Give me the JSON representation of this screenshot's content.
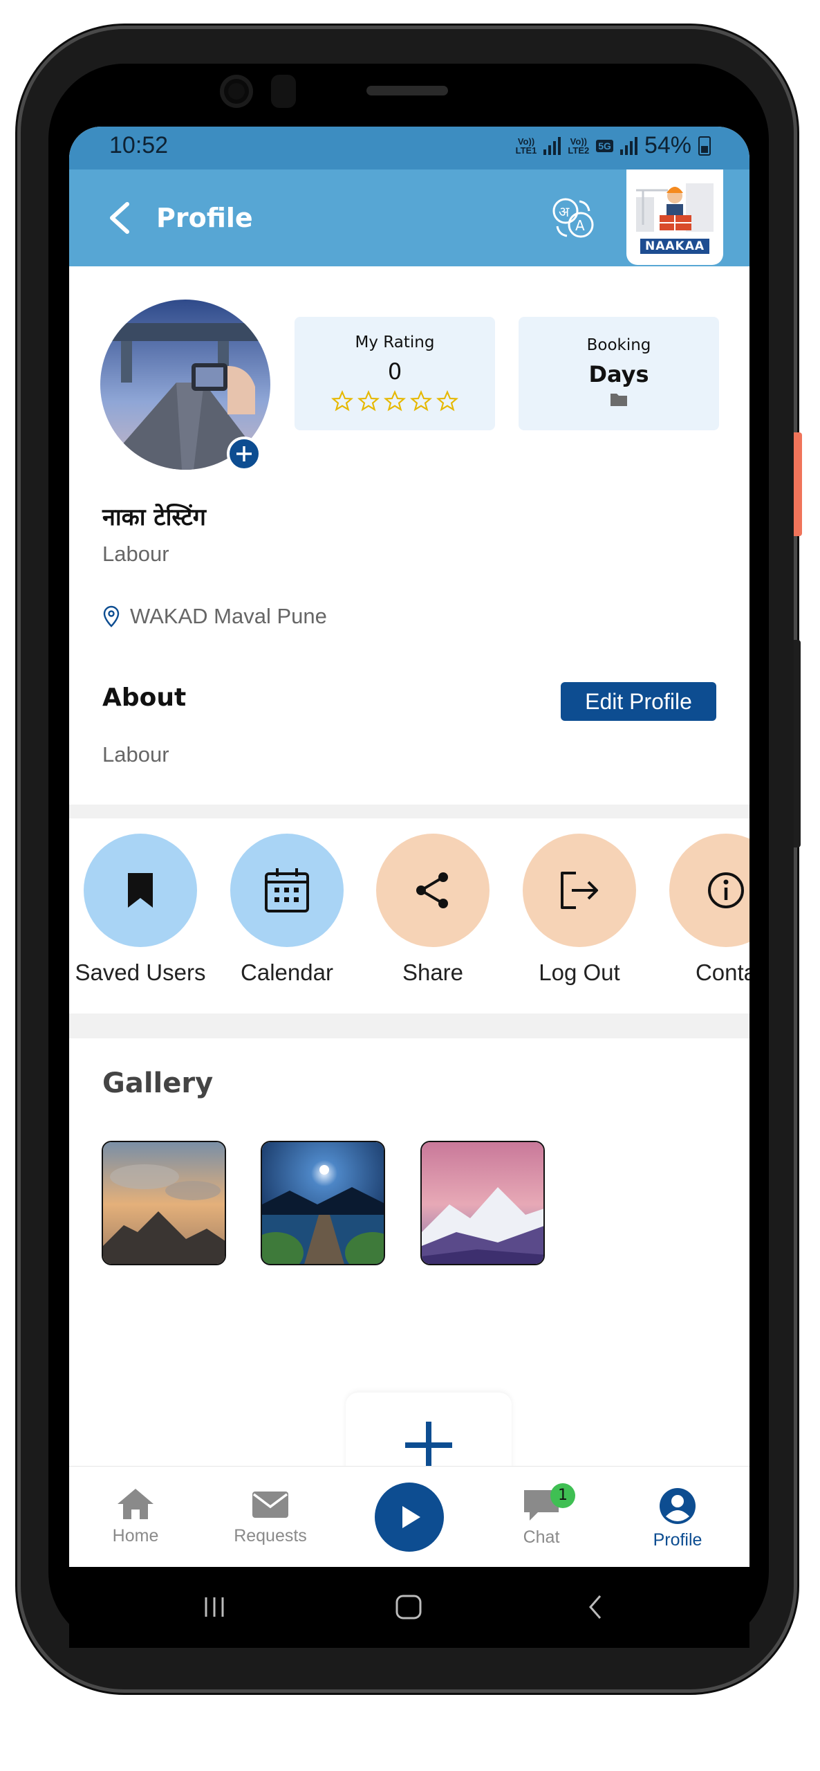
{
  "status_bar": {
    "time": "10:52",
    "sim1_label_top": "Vo))",
    "sim1_label_bottom": "LTE1",
    "sim2_label_top": "Vo))",
    "sim2_label_bottom": "LTE2",
    "network": "5G",
    "battery": "54%"
  },
  "app_bar": {
    "title": "Profile",
    "logo_text": "NAAKAA",
    "translate_icon": "translate-icon",
    "back_icon": "back-arrow-icon"
  },
  "stats": {
    "rating_label": "My Rating",
    "rating_value": "0",
    "stars_filled": 0,
    "stars_total": 5,
    "booking_label": "Booking",
    "booking_value": "Days"
  },
  "profile": {
    "name": "नाका टेस्टिंग",
    "role": "Labour",
    "location": "WAKAD Maval Pune"
  },
  "about": {
    "heading": "About",
    "edit_button": "Edit Profile",
    "text": "Labour"
  },
  "actions": [
    {
      "label": "Saved Users",
      "icon": "bookmark-icon"
    },
    {
      "label": "Calendar",
      "icon": "calendar-icon"
    },
    {
      "label": "Share",
      "icon": "share-icon"
    },
    {
      "label": "Log Out",
      "icon": "logout-icon"
    },
    {
      "label": "Conta",
      "icon": "info-icon"
    }
  ],
  "gallery": {
    "heading": "Gallery"
  },
  "bottom_nav": [
    {
      "label": "Home",
      "icon": "home-icon"
    },
    {
      "label": "Requests",
      "icon": "mail-icon"
    },
    {
      "label": "",
      "icon": "play-icon"
    },
    {
      "label": "Chat",
      "icon": "chat-icon",
      "badge": "1"
    },
    {
      "label": "Profile",
      "icon": "profile-icon",
      "active": true
    }
  ],
  "colors": {
    "status_bar": "#3d8dc1",
    "app_bar": "#57a6d4",
    "primary": "#0d4d91",
    "star": "#e6b800",
    "action_blue": "#a9d4f5",
    "action_peach": "#f6d3b6",
    "badge": "#3fbf53"
  }
}
